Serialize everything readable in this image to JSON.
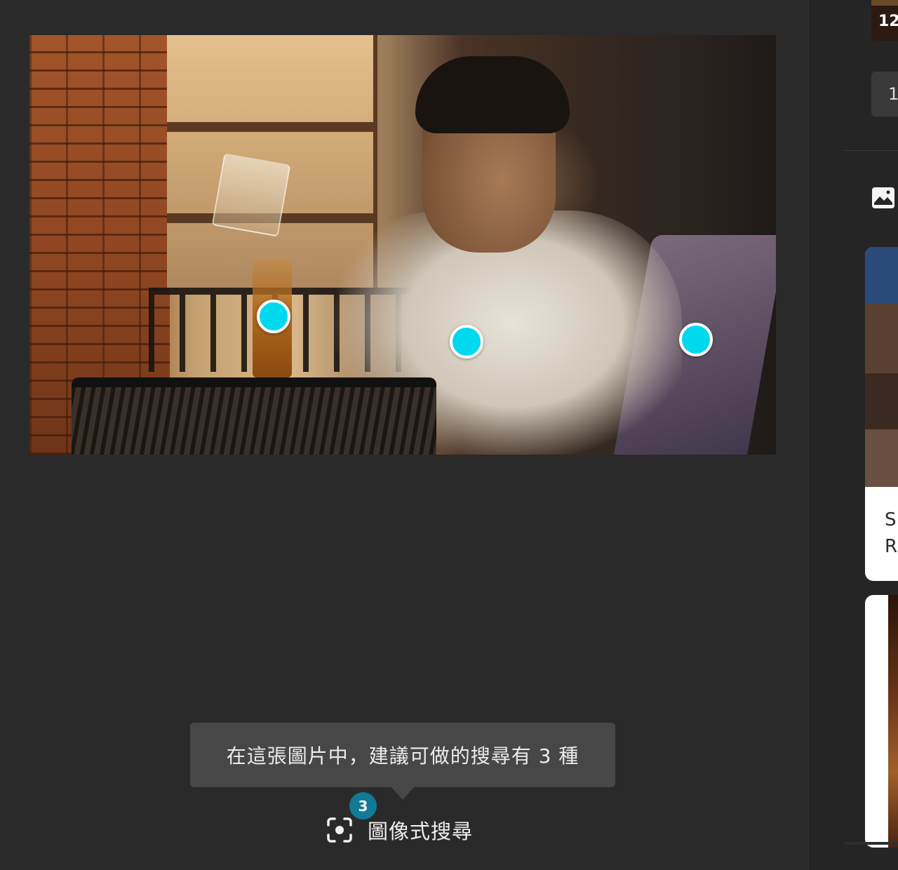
{
  "tooltip": {
    "text": "在這張圖片中，建議可做的搜尋有 3 種"
  },
  "visual_search": {
    "label": "圖像式搜尋",
    "badge_count": "3",
    "icon": "visual-search-icon"
  },
  "hotspots": [
    {
      "name": "hotspot-bottle"
    },
    {
      "name": "hotspot-shirt"
    },
    {
      "name": "hotspot-chair"
    }
  ],
  "right_panel": {
    "thumbnail_count": "12",
    "page_button": "1",
    "image_icon": "image-icon",
    "card1_text_line1": "S",
    "card1_text_line2": "R"
  },
  "colors": {
    "hotspot": "#00d8ee",
    "badge": "#117a94",
    "tooltip_bg": "#474747",
    "background": "#2a2a2a"
  }
}
